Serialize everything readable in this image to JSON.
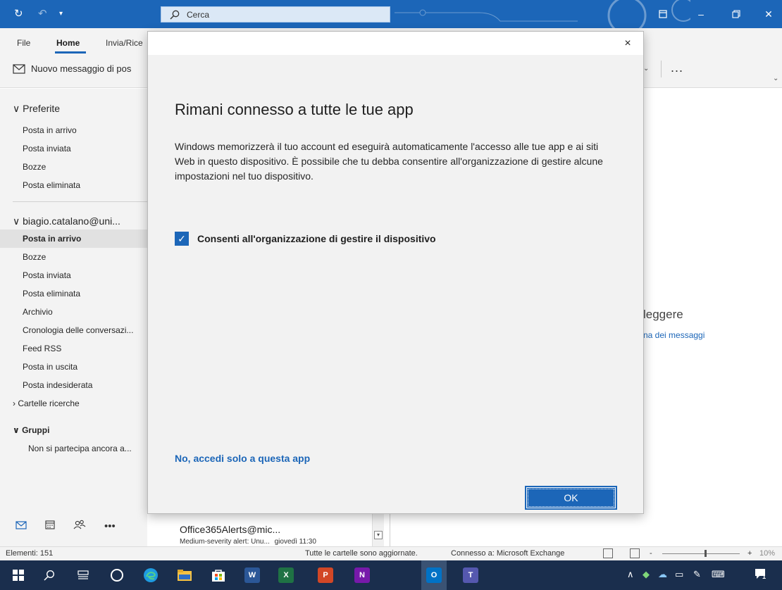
{
  "titlebar": {
    "search_label": "Cerca",
    "icons": [
      "sync-icon",
      "undo-icon",
      "customize-icon",
      "restore-window-icon",
      "minimize-icon",
      "maximize-icon",
      "close-icon"
    ]
  },
  "ribbon": {
    "tabs": [
      "File",
      "Home",
      "Invia/Rice"
    ],
    "active_tab": "Home",
    "new_message_label": "Nuovo messaggio di pos",
    "more_label": "..."
  },
  "nav": {
    "favorites_header": "Preferite",
    "favorites": [
      "Posta in arrivo",
      "Posta inviata",
      "Bozze",
      "Posta eliminata"
    ],
    "account_header": "biagio.catalano@uni...",
    "folders": [
      "Posta in arrivo",
      "Bozze",
      "Posta inviata",
      "Posta eliminata",
      "Archivio",
      "Cronologia delle conversazi...",
      "Feed RSS",
      "Posta in uscita",
      "Posta indesiderata"
    ],
    "search_folders": "Cartelle ricerche",
    "groups_header": "Gruppi",
    "groups_text": "Non si partecipa ancora a..."
  },
  "message_peek": {
    "from": "Office365Alerts@mic...",
    "subject": "Medium-severity alert: Unu...",
    "date": "giovedì 11:30"
  },
  "reading_pane": {
    "title_fragment": "leggere",
    "link_fragment": "na dei messaggi"
  },
  "statusbar": {
    "items": "Elementi: 151",
    "sync_status": "Tutte le cartelle sono aggiornate.",
    "connection": "Connesso a: Microsoft Exchange",
    "zoom_minus": "-",
    "zoom_plus": "+",
    "zoom": "10%"
  },
  "dialog": {
    "title": "Rimani connesso a tutte le tue app",
    "body": "Windows memorizzerà il tuo account ed eseguirà automaticamente l'accesso alle tue app e ai siti Web in questo dispositivo. È possibile che tu debba consentire all'organizzazione di gestire alcune impostazioni nel tuo dispositivo.",
    "checkbox_label": "Consenti all'organizzazione di gestire il dispositivo",
    "checkbox_checked": true,
    "link_label": "No, accedi solo a questa app",
    "ok_label": "OK",
    "close_glyph": "×"
  },
  "taskbar": {
    "apps": [
      "start-icon",
      "search-icon",
      "task-view-icon",
      "cortana-icon",
      "edge-icon",
      "file-explorer-icon",
      "store-icon",
      "word-icon",
      "excel-icon",
      "powerpoint-icon",
      "onenote-icon",
      "outlook-icon",
      "teams-icon"
    ],
    "notification_count": "1"
  },
  "colors": {
    "accent": "#1c66b8",
    "titlebar": "#1c66b8",
    "taskbar": "#1a2e4d",
    "nav_bg": "#f3f3f3",
    "dialog_body": "#f2f2f2"
  }
}
